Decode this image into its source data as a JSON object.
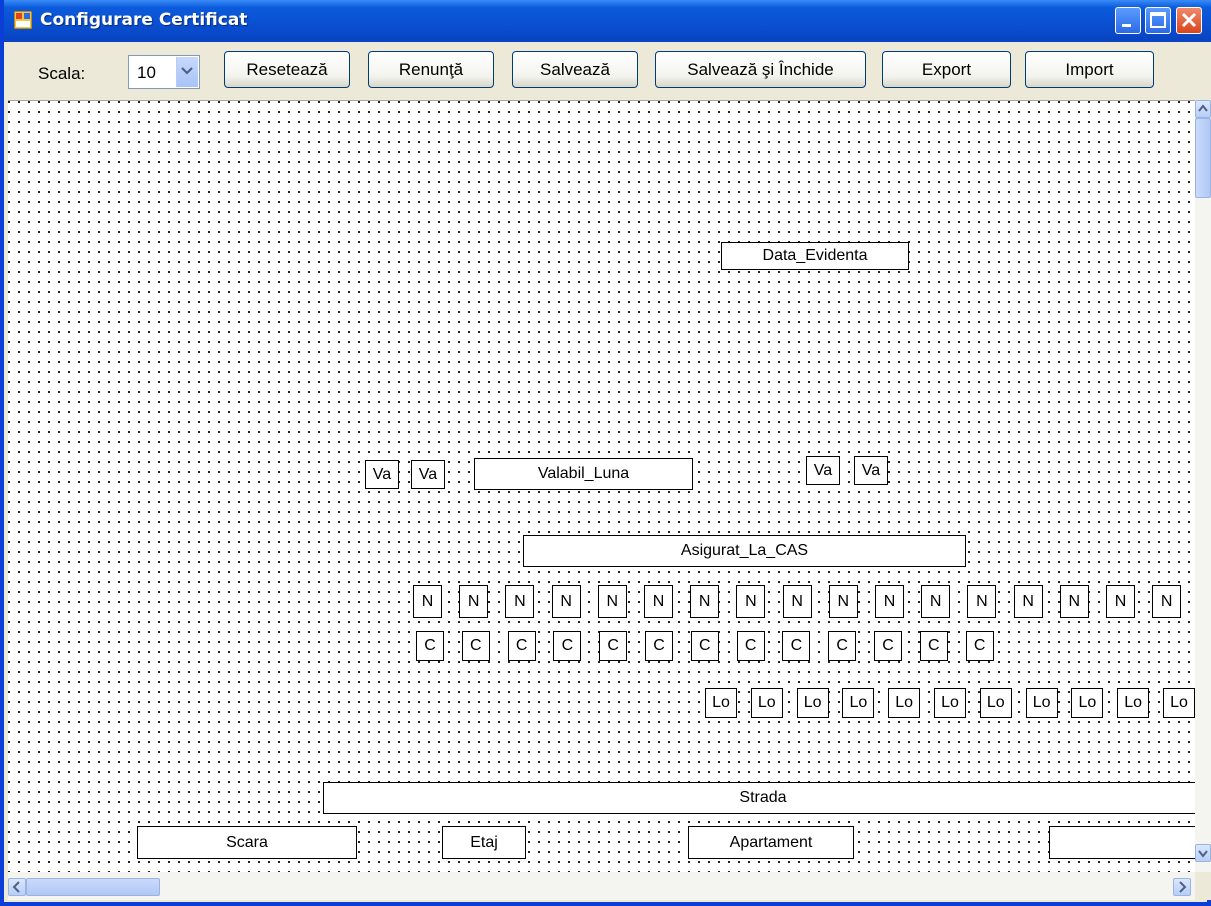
{
  "window": {
    "title": "Configurare Certificat"
  },
  "toolbar": {
    "scala_label": "Scala:",
    "scala_value": "10",
    "buttons": [
      "Resetează",
      "Renunţă",
      "Salvează",
      "Salvează şi Închide",
      "Export",
      "Import"
    ]
  },
  "canvas_fields": {
    "data_evidenta": "Data_Evidenta",
    "va": "Va",
    "valabil_luna": "Valabil_Luna",
    "asigurat_la_cas": "Asigurat_La_CAS",
    "n": "N",
    "c": "C",
    "lo": "Lo",
    "strada": "Strada",
    "scara": "Scara",
    "etaj": "Etaj",
    "apartament": "Apartament",
    "last": ""
  },
  "counts": {
    "n_boxes": 17,
    "c_boxes": 13,
    "lo_boxes": 11
  },
  "colors": {
    "titlebar": "#0a4fd0",
    "window_bg": "#ece9d8"
  }
}
